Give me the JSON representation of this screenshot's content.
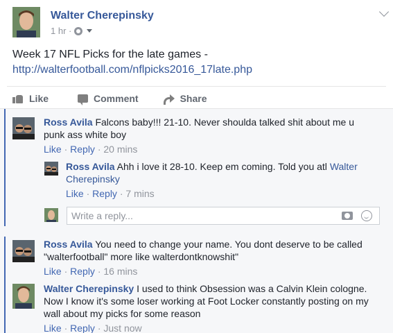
{
  "post": {
    "author": "Walter Cherepinsky",
    "time": "1 hr ·",
    "text": "Week 17 NFL Picks for the late games -",
    "link": "http://walterfootball.com/nflpicks2016_17late.php"
  },
  "actions": {
    "like": "Like",
    "comment": "Comment",
    "share": "Share"
  },
  "comments": [
    {
      "author": "Ross Avila",
      "text": "Falcons baby!!! 21-10. Never shoulda talked shit about me u punk ass white boy",
      "like": "Like",
      "reply": "Reply",
      "time": "20 mins"
    },
    {
      "author": "Ross Avila",
      "text": "You need to change your name. You dont deserve to be called \"walterfootball\" more like walterdontknowshit\"",
      "like": "Like",
      "reply": "Reply",
      "time": "16 mins"
    },
    {
      "author": "Walter Cherepinsky",
      "text": "I used to think Obsession was a Calvin Klein cologne. Now I know it's some loser working at Foot Locker constantly posting on my wall about my picks for some reason",
      "like": "Like",
      "reply": "Reply",
      "time": "Just now"
    }
  ],
  "reply": {
    "author": "Ross Avila",
    "text": "Ahh i love it 28-10. Keep em coming. Told you atl",
    "mention": "Walter Cherepinsky",
    "like": "Like",
    "reply": "Reply",
    "time": "7 mins"
  },
  "reply_box": {
    "placeholder": "Write a reply..."
  },
  "colors": {
    "link": "#365899",
    "thread_bar": "#4267b2",
    "meta": "#90949c"
  }
}
